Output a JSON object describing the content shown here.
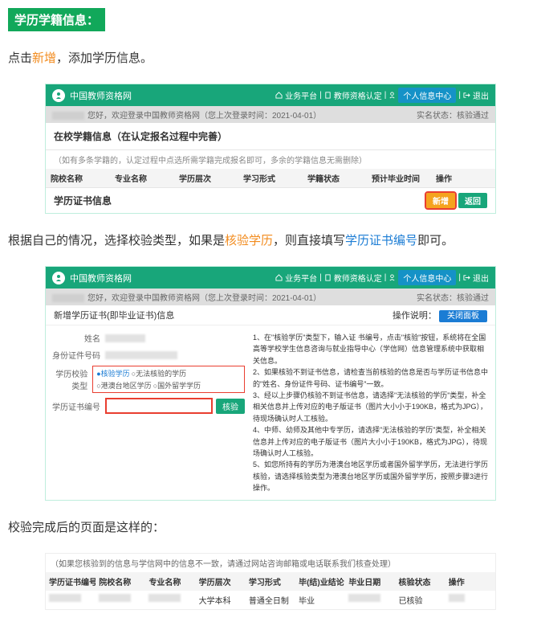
{
  "section_title": "学历学籍信息：",
  "para1_pre": "点击",
  "para1_em": "新增",
  "para1_post": "，添加学历信息。",
  "topbar": {
    "site": "中国教师资格网",
    "links": {
      "biz": "业务平台",
      "cert": "教师资格认定",
      "personal": "个人信息中心",
      "exit": "退出"
    }
  },
  "strip": {
    "greeting_mid": "您好，欢迎登录中国教师资格网（您上次登录时间：2021-04-01）",
    "realname_label": "实名状态：",
    "realname_value": "核验通过"
  },
  "shot1": {
    "title": "在校学籍信息（在认定报名过程中完善）",
    "note": "（如有多条学籍的，认定过程中点选所需学籍完成报名即可，多余的学籍信息无需删除）",
    "headers": [
      "院校名称",
      "专业名称",
      "学历层次",
      "学习形式",
      "学籍状态",
      "预计毕业时间",
      "操作"
    ],
    "footer_title": "学历证书信息",
    "btn_add": "新增",
    "btn_ret": "返回"
  },
  "para2_pre": "根据自己的情况，选择校验类型，如果是",
  "para2_em1": "核验学历",
  "para2_mid": "，则直接填写",
  "para2_em2": "学历证书编号",
  "para2_post": "即可。",
  "shot2": {
    "title": "新增学历证书(即毕业证书)信息",
    "op_label": "操作说明：",
    "op_btn": "关闭面板",
    "labels": {
      "name": "姓名",
      "idno": "身份证件号码",
      "vtype": "学历校验类型",
      "certno": "学历证书编号"
    },
    "radios": [
      "●核验学历",
      "○无法核验的学历",
      "○港澳台地区学历",
      "○国外留学学历"
    ],
    "btn_verify": "核验",
    "instructions": "1、在\"核验学历\"类型下，输入证 书编号，点击\"核验\"按钮，系统将在全国高等学校学生信息咨询与就业指导中心（学信网）信息管理系统中获取相关信息。\n2、如果核验不到证书信息，请检查当前核验的信息是否与学历证书信息中的\"姓名、身份证件号码、证书编号\"一致。\n3、经以上步骤仍核验不到证书信息，请选择\"无法核验的学历\"类型，补全相关信息并上传对应的电子版证书（图片大小小于190KB，格式为JPG），待现场确认时人工核验。\n4、中师、幼师及其他中专学历，请选择\"无法核验的学历\"类型，补全相关信息并上传对应的电子版证书（图片大小小于190KB，格式为JPG），待现场确认时人工核验。\n5、如您所持有的学历为港澳台地区学历或者国外留学学历，无法进行学历核验，请选择核验类型为港澳台地区学历或国外留学学历，按照步骤3进行操作。"
  },
  "para3": "校验完成后的页面是这样的：",
  "shot3": {
    "note": "（如果您核验到的信息与学信网中的信息不一致，请通过网站咨询邮箱或电话联系我们核查处理）",
    "headers": [
      "学历证书编号",
      "院校名称",
      "专业名称",
      "学历层次",
      "学习形式",
      "毕(结)业结论",
      "毕业日期",
      "核验状态",
      "操作"
    ],
    "row": {
      "level": "大学本科",
      "form": "普通全日制",
      "conc": "毕业",
      "status": "已核验"
    }
  }
}
